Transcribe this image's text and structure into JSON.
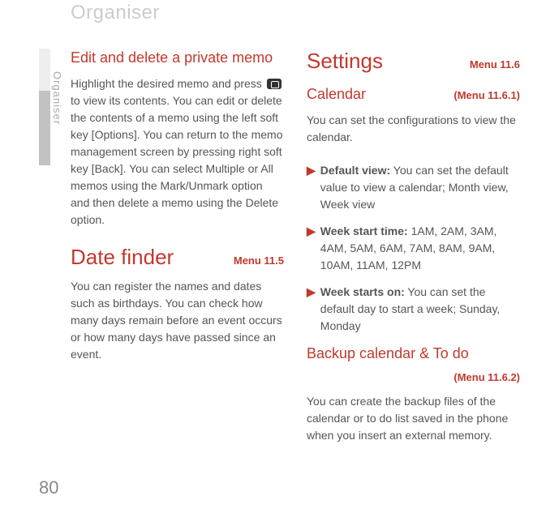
{
  "page_header": "Organiser",
  "side_tab_label": "Organiser",
  "page_number": "80",
  "left": {
    "sec1": {
      "title": "Edit and delete a private memo",
      "body_before_icon": "Highlight the desired memo and press ",
      "body_after_icon": " to view its contents. You can edit or delete the contents of a memo using the left soft key [Options]. You can return to the memo management screen by pressing right soft key [Back]. You can select Multiple or All memos using the Mark/Unmark option and then delete a memo using the Delete option."
    },
    "sec2": {
      "title": "Date finder",
      "menu": "Menu 11.5",
      "body": "You can register the names and dates such as birthdays. You can check how many days remain before an event occurs or how many days have passed since an event."
    }
  },
  "right": {
    "settings": {
      "title": "Settings",
      "menu": "Menu 11.6"
    },
    "calendar": {
      "title": "Calendar",
      "menu": "(Menu 11.6.1)",
      "intro": "You can set the configurations to view the calendar.",
      "items": [
        {
          "label": "Default view:",
          "text": " You can set the default value to view a calendar; Month view, Week view"
        },
        {
          "label": "Week start time:",
          "text": " 1AM, 2AM, 3AM, 4AM, 5AM, 6AM, 7AM, 8AM, 9AM, 10AM, 11AM, 12PM"
        },
        {
          "label": "Week starts on:",
          "text": " You can set the default day to start a week; Sunday, Monday"
        }
      ]
    },
    "backup": {
      "title": "Backup calendar & To do",
      "menu": "(Menu 11.6.2)",
      "body": "You can create the backup files of the calendar or to do list saved in the phone when you insert an external memory."
    }
  }
}
